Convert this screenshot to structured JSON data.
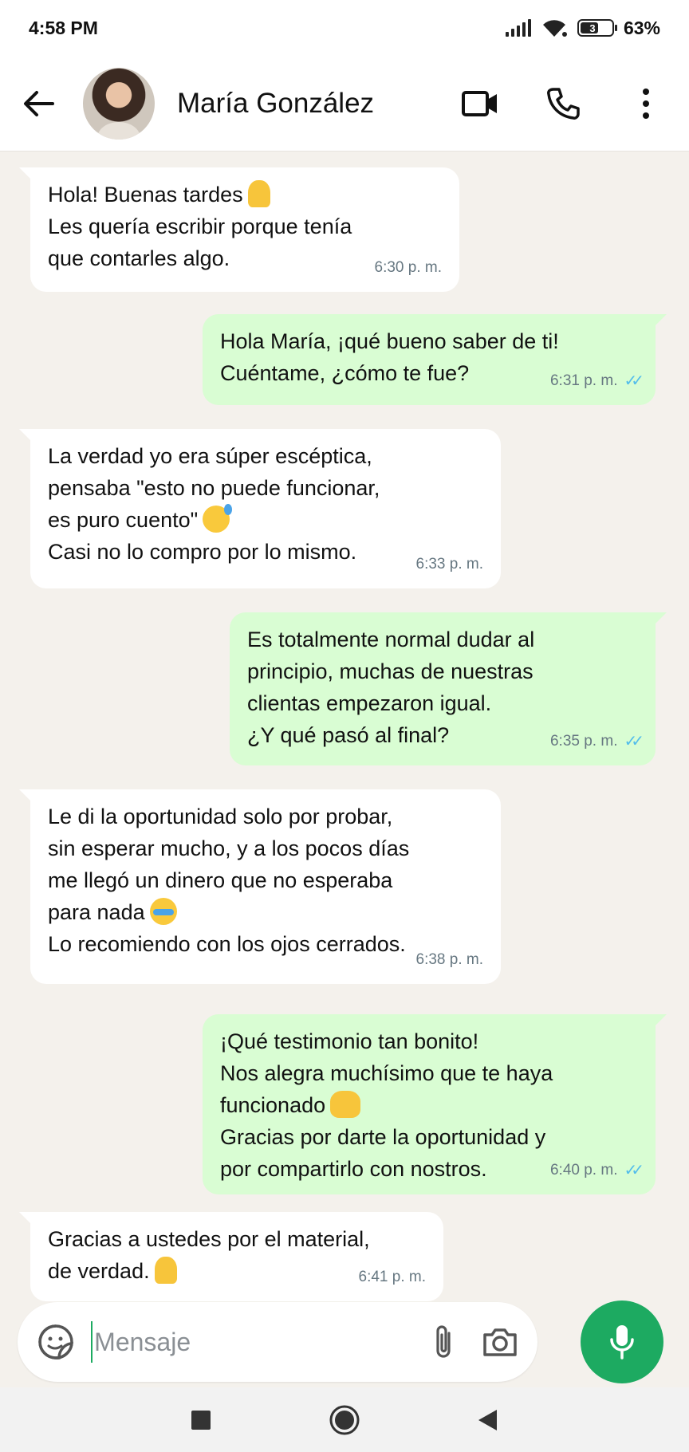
{
  "status_bar": {
    "time": "4:58 PM",
    "battery_badge": "3",
    "battery_percent": "63%",
    "icons": [
      "signal-icon",
      "wifi-icon",
      "battery-icon"
    ]
  },
  "header": {
    "contact_name": "María González",
    "icons": [
      "back-arrow-icon",
      "avatar",
      "video-call-icon",
      "phone-icon",
      "more-vert-icon"
    ]
  },
  "messages": [
    {
      "direction": "in",
      "lines": [
        "Hola! Buenas tardes",
        "Les quería escribir porque tenía",
        "que contarles algo."
      ],
      "emoji": "pray",
      "time": "6:30 p. m."
    },
    {
      "direction": "out",
      "lines": [
        "Hola María, ¡qué bueno saber de ti!",
        "Cuéntame, ¿cómo te fue?"
      ],
      "time": "6:31 p. m.",
      "read": true
    },
    {
      "direction": "in",
      "lines": [
        "La verdad yo era súper escéptica,",
        "pensaba \"esto no puede funcionar,",
        "es puro cuento\"",
        "Casi no lo compro por lo mismo."
      ],
      "emoji": "sweat-smile",
      "time": "6:33 p. m."
    },
    {
      "direction": "out",
      "lines": [
        "Es totalmente normal dudar al",
        "principio, muchas de nuestras",
        "clientas empezaron igual.",
        "¿Y qué pasó al final?"
      ],
      "time": "6:35 p. m.",
      "read": true
    },
    {
      "direction": "in",
      "lines": [
        "Le di la oportunidad solo por probar,",
        "sin esperar mucho, y a los pocos días",
        "me llegó un dinero que no esperaba",
        "para nada",
        "Lo recomiendo con los ojos cerrados."
      ],
      "emoji": "loudly-crying",
      "time": "6:38 p. m."
    },
    {
      "direction": "out",
      "lines": [
        "¡Qué testimonio tan bonito!",
        "Nos alegra muchísimo que te haya",
        "funcionado",
        "Gracias por darte la oportunidad y",
        "por compartirlo con nostros."
      ],
      "emoji": "raising-hands",
      "time": "6:40 p. m.",
      "read": true
    },
    {
      "direction": "in",
      "lines": [
        "Gracias a ustedes por el material,",
        "de verdad."
      ],
      "emoji": "pray",
      "time": "6:41 p. m."
    }
  ],
  "read_ticks": "✓✓",
  "composer": {
    "placeholder": "Mensaje",
    "icons": [
      "sticker-icon",
      "attach-icon",
      "camera-icon",
      "mic-icon"
    ]
  },
  "colors": {
    "accent": "#1daa61",
    "outgoing_bubble": "#d9fdd3",
    "incoming_bubble": "#ffffff",
    "chat_background": "#f4f1ec",
    "read_ticks": "#53bdeb"
  },
  "nav_bar": {
    "icons": [
      "recents-square-icon",
      "home-circle-icon",
      "back-triangle-icon"
    ]
  }
}
